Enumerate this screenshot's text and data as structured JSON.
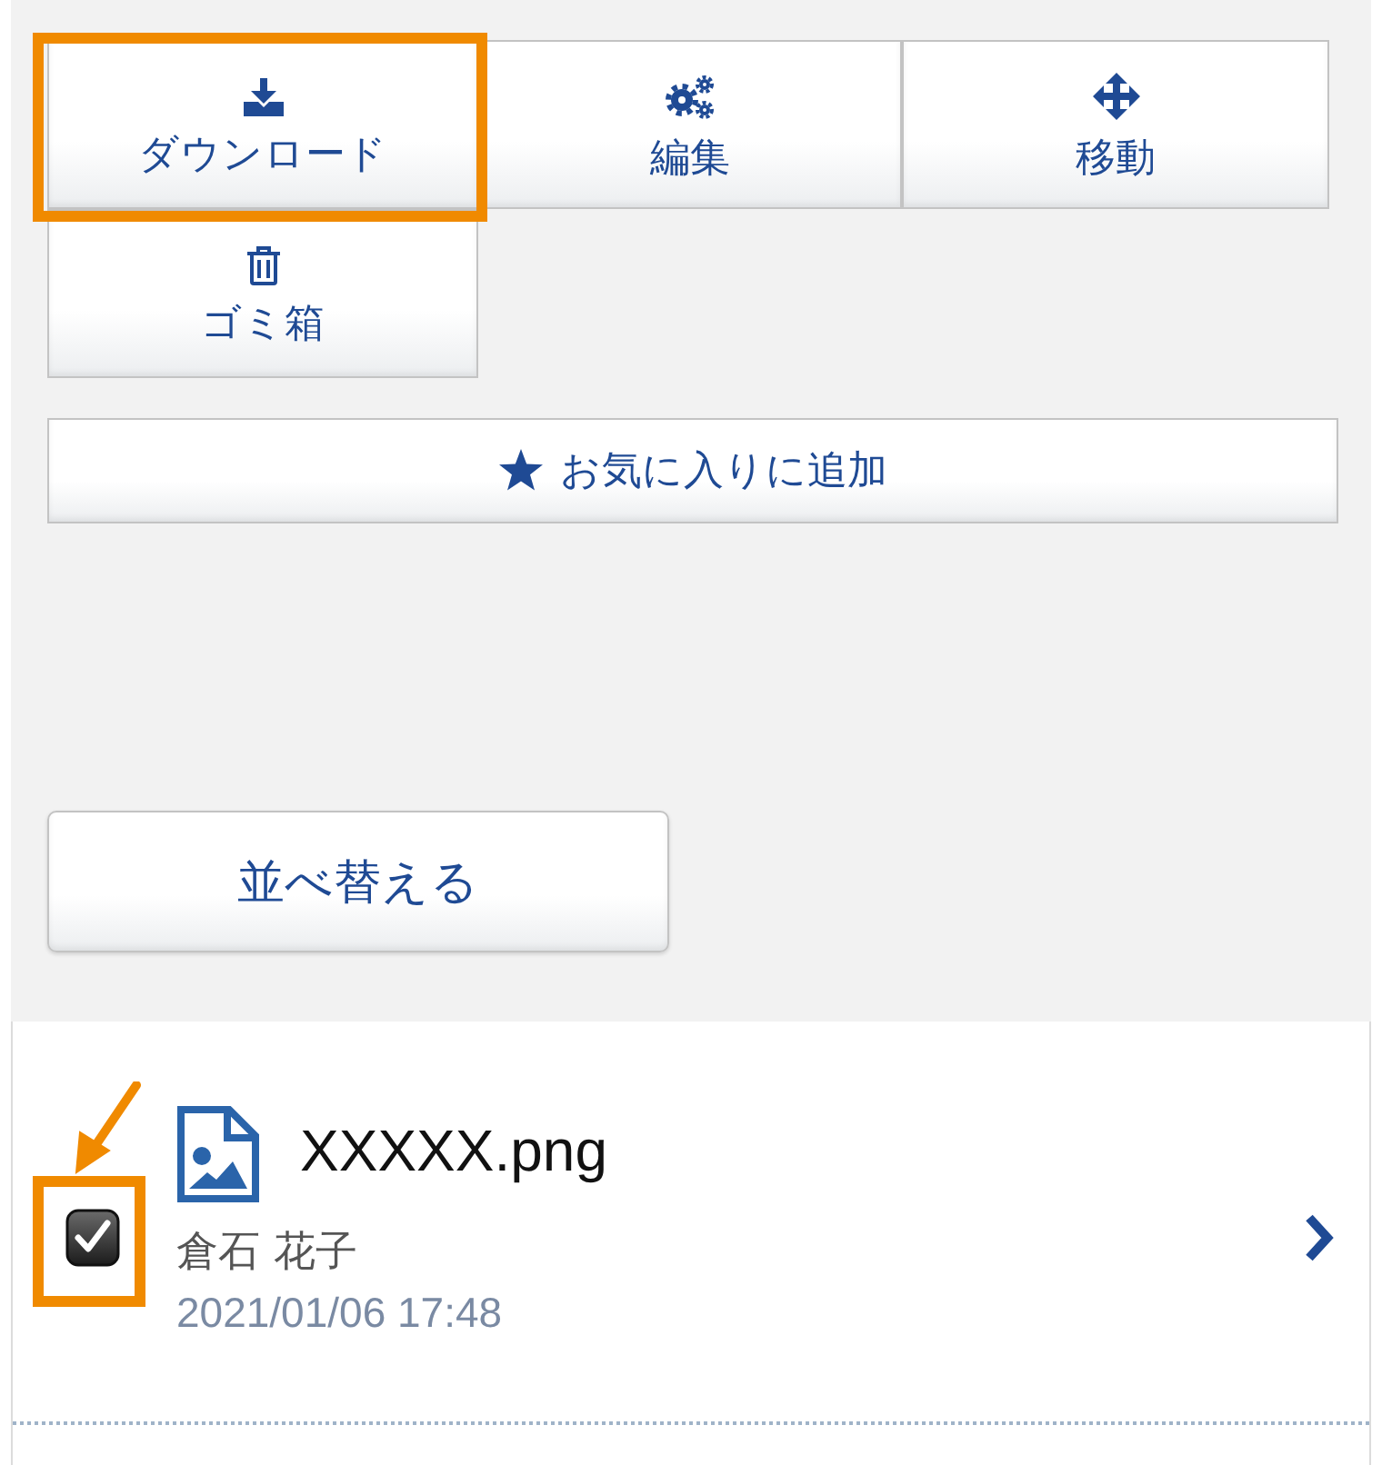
{
  "actions": [
    {
      "kind": "download",
      "label": "ダウンロード",
      "highlighted": true
    },
    {
      "kind": "edit",
      "label": "編集",
      "highlighted": false
    },
    {
      "kind": "move",
      "label": "移動",
      "highlighted": false
    },
    {
      "kind": "trash",
      "label": "ゴミ箱",
      "highlighted": false
    }
  ],
  "favorite_button": {
    "label": "お気に入りに追加"
  },
  "sort_button": {
    "label": "並べ替える"
  },
  "files": [
    {
      "name": "XXXXX.png",
      "owner": "倉石 花子",
      "date": "2021/01/06 17:48",
      "checked": true,
      "highlighted": true
    }
  ]
}
